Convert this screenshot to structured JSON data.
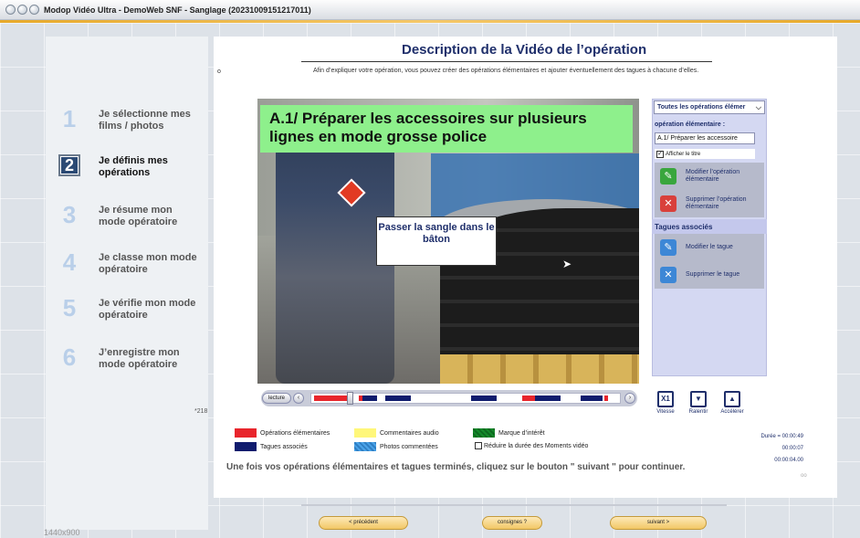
{
  "window": {
    "title": "Modop Vidéo Ultra - DemoWeb SNF - Sanglage (20231009151217011)"
  },
  "steps": [
    {
      "num": "1",
      "label": "Je sélectionne mes films / photos"
    },
    {
      "num": "2",
      "label": "Je définis mes opérations"
    },
    {
      "num": "3",
      "label": "Je résume mon mode opératoire"
    },
    {
      "num": "4",
      "label": "Je classe mon mode opératoire"
    },
    {
      "num": "5",
      "label": "Je vérifie mon mode opératoire"
    },
    {
      "num": "6",
      "label": "J’enregistre mon mode opératoire"
    }
  ],
  "resolution": "1440x900",
  "main": {
    "title": "Description de la Vidéo de l’opération",
    "bullet": "o",
    "intro": "Afin d’expliquer votre opération, vous pouvez créer des opérations élémentaires et ajouter éventuellement des tagues à chacune d’elles."
  },
  "video": {
    "caption": "A.1/ Préparer les accessoires sur plusieurs lignes en mode grosse police",
    "label": "Passer la sangle dans le bâton"
  },
  "right_panel": {
    "select_value": "Toutes les opérations élémer",
    "op_heading": "opération élémentaire :",
    "op_value": "A.1/ Préparer les accessoire",
    "show_title": "Afficher le titre",
    "modify_op": "Modifier l’opération élémentaire",
    "delete_op": "Supprimer l’opération élémentaire",
    "tags_heading": "Tagues associés",
    "modify_tag": "Modifier le tague",
    "delete_tag": "Supprimer le tague"
  },
  "timeline": {
    "play_label": "lecture",
    "prev_icon": "chevron-left-icon",
    "next_icon": "chevron-right-icon",
    "counter": "*218"
  },
  "speed": {
    "rate": "X1",
    "rate_label": "Vitesse",
    "slow_label": "Ralentir",
    "fast_label": "Accélérer"
  },
  "legend": {
    "ops": "Opérations élémentaires",
    "tags": "Tagues associés",
    "audio": "Commentaires audio",
    "photos": "Photos commentées",
    "interest": "Marque d’intérêt",
    "reduce": "Réduire la durée des Moments vidéo"
  },
  "durations": {
    "total": "Durée = 00:00:49",
    "t1": "00:00:07",
    "t2": "00:00:04.00"
  },
  "footer_note": "Une fois vos opérations élémentaires et tagues terminés, cliquez sur le bouton \" suivant \" pour continuer.",
  "footer_oo": "oo",
  "nav": {
    "prev": "< précédent",
    "instructions": "consignes ?",
    "next": "suivant >"
  },
  "colors": {
    "accent_navy": "#1f2f6b",
    "caption_green": "#8ef08c",
    "ops_red": "#e8252c",
    "tags_navy": "#101c6e",
    "audio_yellow": "#fff77a",
    "photos_blue": "#4aa3e8",
    "interest_green": "#138a2a",
    "title_orange": "#e7a92a"
  }
}
